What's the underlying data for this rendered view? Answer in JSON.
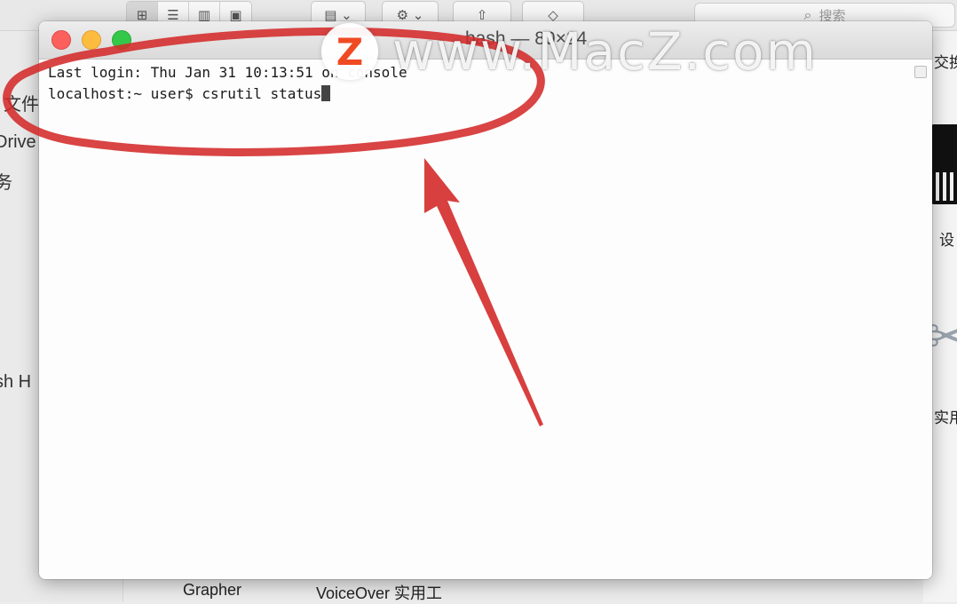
{
  "finder": {
    "search_placeholder": "搜索",
    "sidebar_items": [
      "文件",
      "Drive",
      "务",
      "sh H"
    ],
    "right_labels": [
      "交换",
      "设",
      "实用"
    ],
    "bottom_labels": [
      "Grapher",
      "VoiceOver 实用工"
    ]
  },
  "terminal": {
    "title": "bash — 80×24",
    "lines": [
      "Last login: Thu Jan 31 10:13:51 on console",
      "localhost:~ user$ csrutil status"
    ]
  },
  "watermark": {
    "logo_letter": "Z",
    "text": "www.MacZ.com"
  },
  "annotation": {
    "color": "#d42a2a"
  }
}
